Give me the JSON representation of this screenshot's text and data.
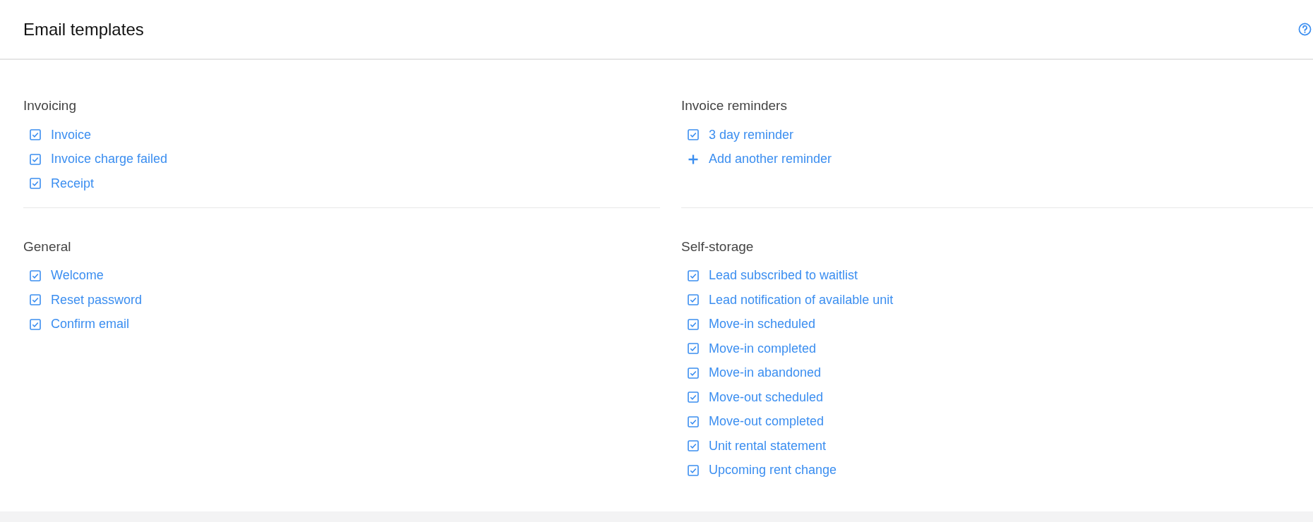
{
  "header": {
    "title": "Email templates"
  },
  "sections": [
    {
      "title": "Invoicing",
      "items": [
        {
          "kind": "checkbox",
          "label": "Invoice",
          "checked": true
        },
        {
          "kind": "checkbox",
          "label": "Invoice charge failed",
          "checked": true
        },
        {
          "kind": "checkbox",
          "label": "Receipt",
          "checked": true
        }
      ]
    },
    {
      "title": "Invoice reminders",
      "items": [
        {
          "kind": "checkbox",
          "label": "3 day reminder",
          "checked": true
        },
        {
          "kind": "add",
          "label": "Add another reminder"
        }
      ]
    },
    {
      "title": "General",
      "items": [
        {
          "kind": "checkbox",
          "label": "Welcome",
          "checked": true
        },
        {
          "kind": "checkbox",
          "label": "Reset password",
          "checked": true
        },
        {
          "kind": "checkbox",
          "label": "Confirm email",
          "checked": true
        }
      ]
    },
    {
      "title": "Self-storage",
      "items": [
        {
          "kind": "checkbox",
          "label": "Lead subscribed to waitlist",
          "checked": true
        },
        {
          "kind": "checkbox",
          "label": "Lead notification of available unit",
          "checked": true
        },
        {
          "kind": "checkbox",
          "label": "Move-in scheduled",
          "checked": true
        },
        {
          "kind": "checkbox",
          "label": "Move-in completed",
          "checked": true
        },
        {
          "kind": "checkbox",
          "label": "Move-in abandoned",
          "checked": true
        },
        {
          "kind": "checkbox",
          "label": "Move-out scheduled",
          "checked": true
        },
        {
          "kind": "checkbox",
          "label": "Move-out completed",
          "checked": true
        },
        {
          "kind": "checkbox",
          "label": "Unit rental statement",
          "checked": true
        },
        {
          "kind": "checkbox",
          "label": "Upcoming rent change",
          "checked": true
        }
      ]
    }
  ]
}
